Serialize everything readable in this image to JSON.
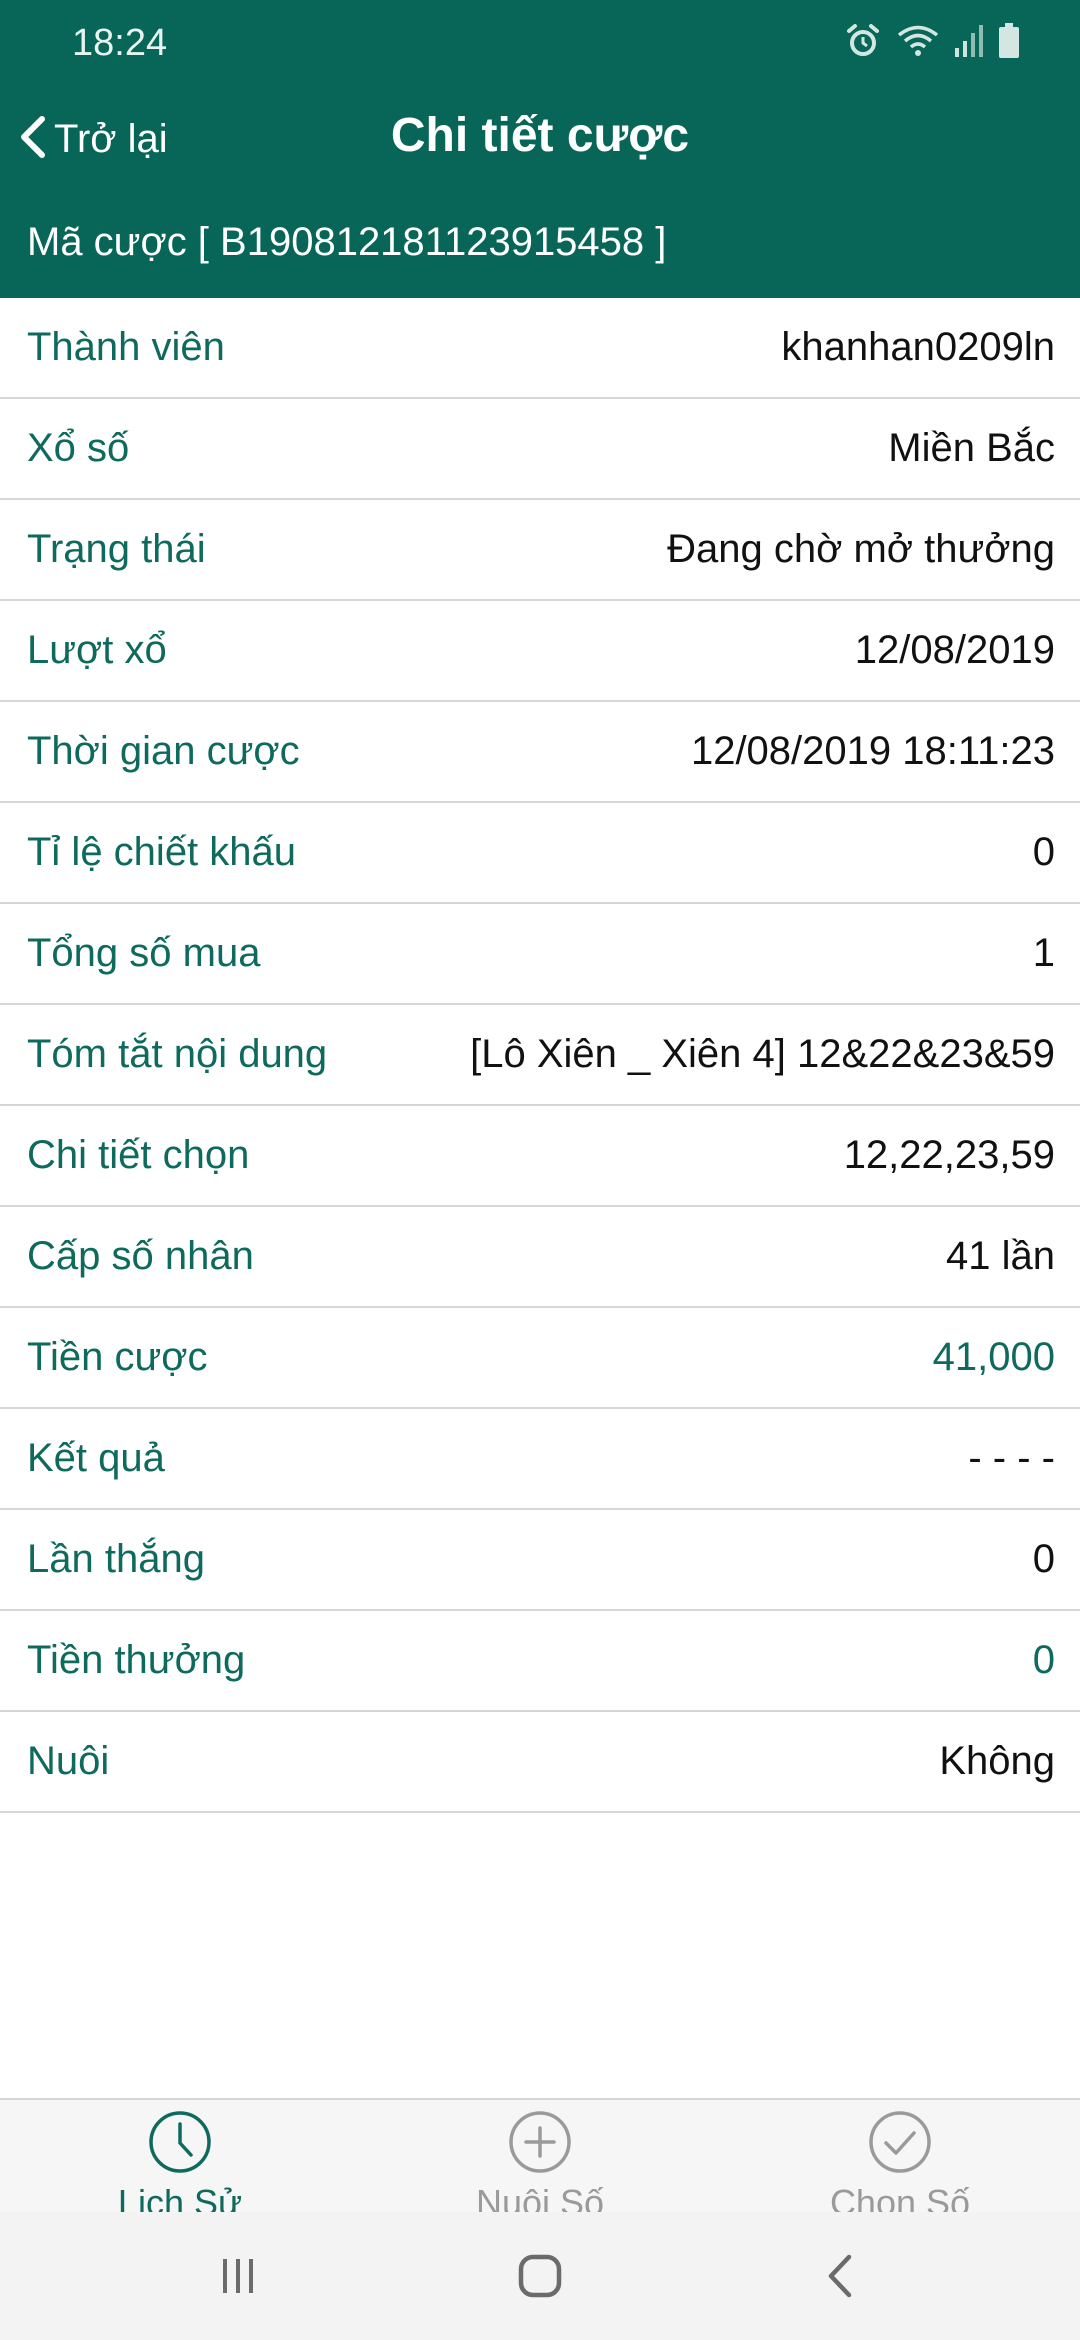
{
  "status_bar": {
    "time": "18:24",
    "icons": [
      "alarm-icon",
      "wifi-icon",
      "signal-icon",
      "battery-icon"
    ]
  },
  "nav": {
    "back_label": "Trở lại",
    "title": "Chi tiết cược"
  },
  "bet_code": "Mã cược [ B190812181123915458 ]",
  "details": [
    {
      "label": "Thành viên",
      "value": "khanhan0209ln"
    },
    {
      "label": "Xổ số",
      "value": "Miền Bắc"
    },
    {
      "label": "Trạng thái",
      "value": "Đang chờ mở thưởng"
    },
    {
      "label": "Lượt xổ",
      "value": "12/08/2019"
    },
    {
      "label": "Thời gian cược",
      "value": "12/08/2019 18:11:23"
    },
    {
      "label": "Tỉ lệ chiết khấu",
      "value": "0"
    },
    {
      "label": "Tổng số mua",
      "value": "1"
    },
    {
      "label": "Tóm tắt nội dung",
      "value": "[Lô Xiên _ Xiên 4] 12&22&23&59"
    },
    {
      "label": "Chi tiết chọn",
      "value": "12,22,23,59"
    },
    {
      "label": "Cấp số nhân",
      "value": "41 lần"
    },
    {
      "label": "Tiền cược",
      "value": "41,000"
    },
    {
      "label": "Kết quả",
      "value": "- - - -"
    },
    {
      "label": "Lần thắng",
      "value": "0"
    },
    {
      "label": "Tiền thưởng",
      "value": "0"
    },
    {
      "label": "Nuôi",
      "value": "Không"
    }
  ],
  "tabs": [
    {
      "label": "Lịch Sử",
      "icon": "clock-icon",
      "active": true
    },
    {
      "label": "Nuôi Số",
      "icon": "plus-circle-icon",
      "active": false
    },
    {
      "label": "Chọn Số",
      "icon": "check-circle-icon",
      "active": false
    }
  ],
  "system_nav": [
    "recent-apps-icon",
    "home-icon",
    "back-icon"
  ],
  "colors": {
    "header_bg": "#076657",
    "accent": "#0d6a5c",
    "inactive_tab": "#9a9a9a",
    "divider": "#d6d6d6"
  }
}
